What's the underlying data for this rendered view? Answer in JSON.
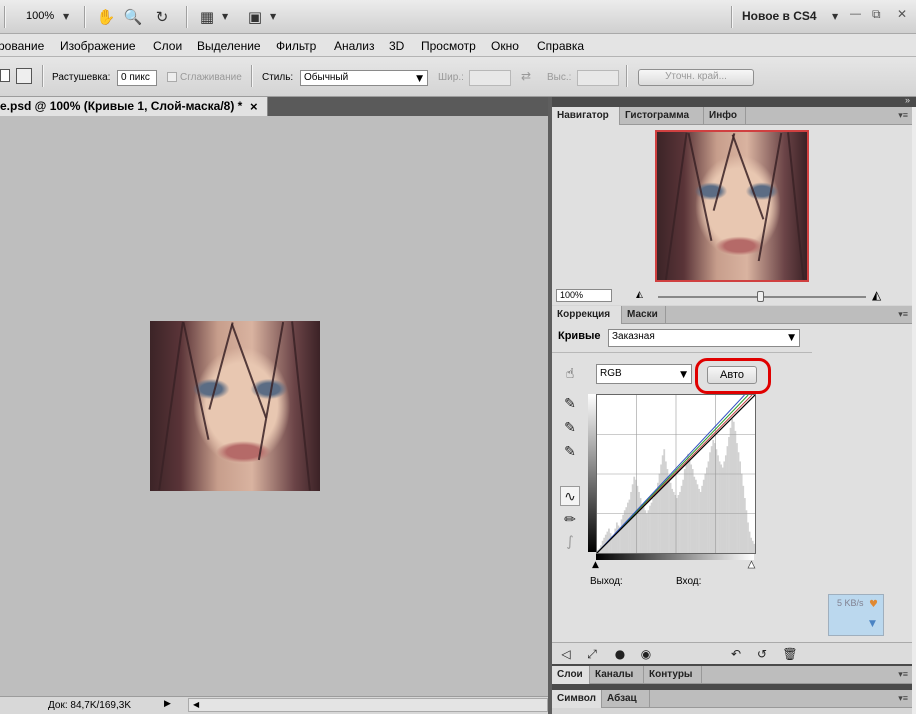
{
  "appbar": {
    "zoom": "100%",
    "workspace": "Новое в CS4",
    "window_controls": {
      "minimize": "—",
      "restore": "⧉",
      "close": "✕"
    }
  },
  "menu": [
    "рование",
    "Изображение",
    "Слои",
    "Выделение",
    "Фильтр",
    "Анализ",
    "3D",
    "Просмотр",
    "Окно",
    "Справка"
  ],
  "options": {
    "feather_label": "Растушевка:",
    "feather_value": "0 пикс",
    "antialias_label": "Сглаживание",
    "style_label": "Стиль:",
    "style_value": "Обычный",
    "width_label": "Шир.:",
    "height_label": "Выс.:",
    "refine_edge": "Уточн. край..."
  },
  "document": {
    "tab_title": "e.psd @ 100% (Кривые 1, Слой-маска/8) *",
    "close": "×",
    "status": "Док: 84,7K/169,3K"
  },
  "navigator": {
    "tabs": [
      "Навигатор",
      "Гистограмма",
      "Инфо"
    ],
    "zoom": "100%"
  },
  "adjustments": {
    "tabs": [
      "Коррекция",
      "Маски"
    ],
    "curves_label": "Кривые",
    "preset": "Заказная",
    "channel": "RGB",
    "auto_button": "Авто",
    "output_label": "Выход:",
    "input_label": "Вход:"
  },
  "speed_widget": {
    "text": "5 KB/s"
  },
  "bottom_panels": {
    "group1_tabs": [
      "Слои",
      "Каналы",
      "Контуры"
    ],
    "group2_tabs": [
      "Символ",
      "Абзац"
    ]
  },
  "chart_data": {
    "type": "line",
    "histogram": [
      2,
      3,
      5,
      8,
      10,
      12,
      14,
      16,
      13,
      11,
      12,
      16,
      20,
      18,
      17,
      22,
      25,
      28,
      30,
      33,
      35,
      40,
      45,
      50,
      48,
      44,
      40,
      36,
      32,
      30,
      28,
      26,
      28,
      31,
      33,
      36,
      38,
      42,
      46,
      52,
      58,
      64,
      68,
      60,
      55,
      50,
      46,
      42,
      40,
      38,
      36,
      38,
      40,
      44,
      48,
      55,
      60,
      65,
      62,
      58,
      55,
      50,
      48,
      45,
      42,
      40,
      44,
      48,
      52,
      56,
      60,
      66,
      70,
      74,
      72,
      68,
      64,
      60,
      58,
      56,
      60,
      64,
      70,
      76,
      82,
      88,
      86,
      80,
      72,
      66,
      60,
      52,
      44,
      36,
      28,
      20,
      14,
      10,
      8,
      6
    ],
    "curve": [
      [
        0,
        0
      ],
      [
        255,
        255
      ]
    ],
    "channel_lines": [
      {
        "name": "red",
        "color": "#c04040",
        "points": [
          [
            0,
            0
          ],
          [
            250,
            255
          ]
        ]
      },
      {
        "name": "green",
        "color": "#2a9a2a",
        "points": [
          [
            0,
            0
          ],
          [
            244,
            255
          ]
        ]
      },
      {
        "name": "blue",
        "color": "#3050c0",
        "points": [
          [
            0,
            0
          ],
          [
            238,
            255
          ]
        ]
      }
    ],
    "xlim": [
      0,
      255
    ],
    "ylim": [
      0,
      255
    ]
  }
}
